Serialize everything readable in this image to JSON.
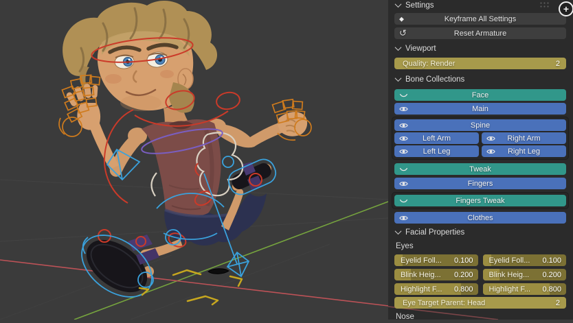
{
  "viewport": {
    "background_color": "#3b3b3b",
    "axis_x_color": "#bd5257",
    "axis_y_color": "#76a43e",
    "floor_marker_color": "#c7a71f",
    "rig_colors": {
      "red": "#cb3a29",
      "orange": "#cf7b1d",
      "blue": "#3aa2dd",
      "white": "#d9d1c3",
      "violet": "#7a5ec2"
    },
    "character_colors": {
      "hair": "#b09055",
      "skin": "#d7a06f",
      "shirt": "#7c4c48",
      "shorts": "#2c3150",
      "sandals": "#17151a",
      "straps": "#4a3a72",
      "iris": "#4d84ba"
    }
  },
  "panel": {
    "background_color": "#2b2b2b",
    "icons": {
      "keyframe": "◆",
      "undo": "↺",
      "plus": "+"
    },
    "settings_label": "Settings",
    "buttons": [
      {
        "label": "Keyframe All Settings"
      },
      {
        "label": "Reset Armature"
      }
    ],
    "viewport_section": {
      "label": "Viewport",
      "quality_slider": {
        "label": "Quality: Render",
        "value": "2"
      }
    },
    "bone_collections": {
      "label": "Bone Collections",
      "teal_color": "#31978a",
      "blue_color": "#4a71ba",
      "items": [
        {
          "label": "Face",
          "eye": "closed"
        },
        {
          "label": "Main",
          "eye": "open"
        },
        {
          "label": "Spine",
          "eye": "open"
        },
        {
          "label": "Left Arm",
          "eye": "open"
        },
        {
          "label": "Right Arm",
          "eye": "open"
        },
        {
          "label": "Left Leg",
          "eye": "open"
        },
        {
          "label": "Right Leg",
          "eye": "open"
        },
        {
          "label": "Tweak",
          "eye": "closed"
        },
        {
          "label": "Fingers",
          "eye": "open"
        },
        {
          "label": "Fingers Tweak",
          "eye": "closed"
        },
        {
          "label": "Clothes",
          "eye": "open"
        }
      ]
    },
    "facial_properties": {
      "label": "Facial Properties"
    },
    "eyes": {
      "label": "Eyes",
      "sliders": [
        {
          "label": "Eyelid Foll...",
          "value": "0.100",
          "fill": 0.1
        },
        {
          "label": "Eyelid Foll...",
          "value": "0.100",
          "fill": 0.1
        },
        {
          "label": "Blink Heig...",
          "value": "0.200",
          "fill": 0.2
        },
        {
          "label": "Blink Heig...",
          "value": "0.200",
          "fill": 0.2
        },
        {
          "label": "Highlight F...",
          "value": "0.800",
          "fill": 0.8
        },
        {
          "label": "Highlight F...",
          "value": "0.800",
          "fill": 0.8
        }
      ],
      "eye_target": {
        "label": "Eye Target Parent: Head",
        "value": "2"
      }
    },
    "next_section_label": "Nose",
    "slider_colors": {
      "full": "#a79a4b",
      "mini_bg": "#7c7134",
      "mini_fill": "#9b8d41"
    }
  }
}
